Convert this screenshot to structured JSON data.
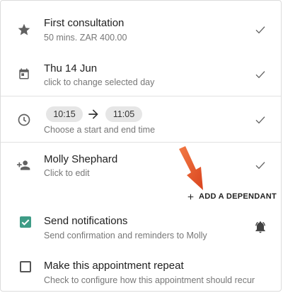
{
  "service": {
    "title": "First consultation",
    "subtitle": "50 mins. ZAR 400.00",
    "icon": "star-icon"
  },
  "date": {
    "title": "Thu 14 Jun",
    "subtitle": "click to change selected day",
    "icon": "calendar-icon"
  },
  "time": {
    "start": "10:15",
    "end": "11:05",
    "subtitle": "Choose a start and end time",
    "icon": "clock-icon"
  },
  "client": {
    "title": "Molly Shephard",
    "subtitle": "Click to edit",
    "icon": "person-add-icon",
    "add_dependant_label": "ADD A DEPENDANT"
  },
  "notifications": {
    "checked": true,
    "title": "Send notifications",
    "subtitle": "Send confirmation and reminders to Molly",
    "icon": "bell-ring-icon"
  },
  "repeat": {
    "checked": false,
    "title": "Make this appointment repeat",
    "subtitle": "Check to configure how this appointment should recur"
  },
  "colors": {
    "accent": "#3e9c86",
    "arrow": "#e8562a",
    "icon": "#616161"
  }
}
